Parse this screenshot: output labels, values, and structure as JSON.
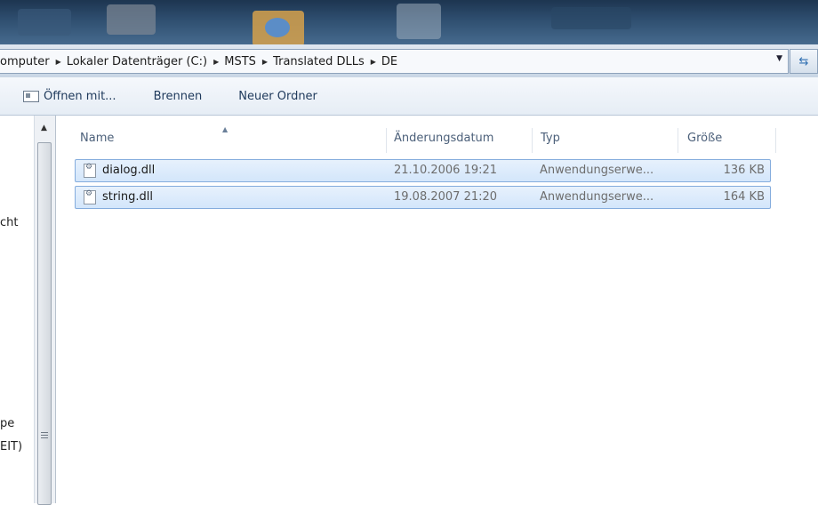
{
  "address": {
    "breadcrumbs": [
      "omputer",
      "Lokaler Datenträger (C:)",
      "MSTS",
      "Translated DLLs",
      "DE"
    ],
    "dropdown_icon": "chevron-down-icon",
    "refresh_icon": "refresh-icon"
  },
  "toolbar": {
    "open_with_label": "Öffnen mit...",
    "burn_label": "Brennen",
    "new_folder_label": "Neuer Ordner"
  },
  "nav_pane": {
    "items": [
      "cht",
      "pe",
      "EIT)"
    ]
  },
  "file_list": {
    "columns": {
      "name": "Name",
      "date": "Änderungsdatum",
      "type": "Typ",
      "size": "Größe"
    },
    "files": [
      {
        "name": "dialog.dll",
        "date": "21.10.2006 19:21",
        "type": "Anwendungserwe...",
        "size": "136 KB",
        "selected": true
      },
      {
        "name": "string.dll",
        "date": "19.08.2007 21:20",
        "type": "Anwendungserwe...",
        "size": "164 KB",
        "selected": true
      }
    ]
  },
  "colors": {
    "selection_fill": "#d3e6fb",
    "selection_border": "#84acdd",
    "toolbar_text": "#1e395b"
  }
}
